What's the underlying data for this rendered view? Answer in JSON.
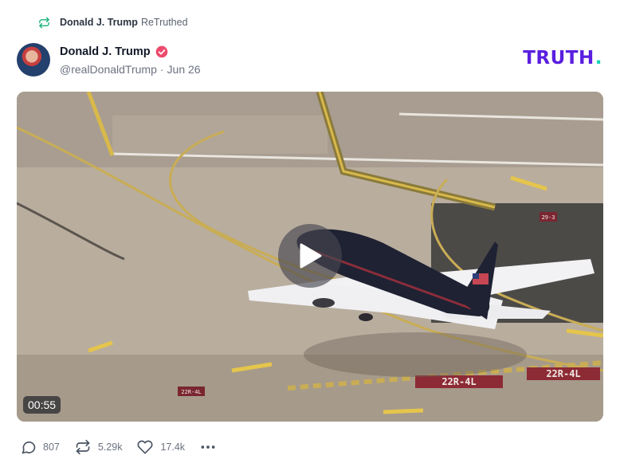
{
  "retruth": {
    "author": "Donald J. Trump",
    "verb": "ReTruthed",
    "icon": "retruth-icon"
  },
  "post": {
    "author_name": "Donald J. Trump",
    "handle": "@realDonaldTrump",
    "separator": "·",
    "date": "Jun 26",
    "verified_icon": "verified-badge-icon"
  },
  "brand": {
    "logo_text": "TRUTH",
    "logo_dot": ".",
    "color": "#5a1fe0",
    "dot_color": "#19d3b5"
  },
  "media": {
    "type": "video",
    "duration": "00:55",
    "runway_sign_1": "22R-4L",
    "runway_sign_2": "22R-4L",
    "small_sign_1": "22R-4L",
    "small_sign_2": "29-3"
  },
  "actions": {
    "replies": "807",
    "retruths": "5.29k",
    "likes": "17.4k",
    "more_icon": "more-dots-icon"
  },
  "colors": {
    "verified": "#ec4b6b",
    "retruth_icon": "#17b27a",
    "meta_text": "#6b7280"
  }
}
